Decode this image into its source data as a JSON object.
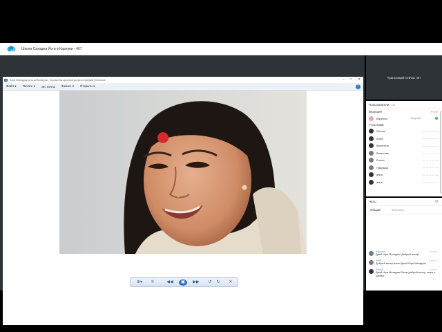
{
  "webinar": {
    "title": "Школа Сахаджа Йоги в Карелии - 407",
    "brand_color": "#2aa6e0"
  },
  "photo_viewer": {
    "window_title": "Шри Матаджи для вебинаров - Средство просмотра фотографий Windows",
    "menu": [
      "Файл ▾",
      "Печать ▾",
      "Эл. почта",
      "Запись ▾",
      "Открыть ▾"
    ],
    "help_label": "?",
    "window_buttons": [
      "–",
      "□",
      "✕"
    ],
    "toolbar_icons": [
      "zoom-icon",
      "fit-icon",
      "previous-icon",
      "slideshow-icon",
      "next-icon",
      "rotate-left-icon",
      "rotate-right-icon",
      "delete-icon"
    ],
    "toolbar_glyphs": [
      "⊕▾",
      "⁜",
      "◀◀",
      "▣",
      "▶▶",
      "↺",
      "↻",
      "✕"
    ]
  },
  "broadcast": {
    "status_text": "Трансляций сейчас нет"
  },
  "participants_panel": {
    "title": "Пользователи",
    "count": "16",
    "hosts_label": "Ведущие",
    "hosts_right": "Роли",
    "hosts": [
      {
        "name": "Карелия",
        "role": "ведущий"
      }
    ],
    "participants_label": "Участники",
    "participants": [
      {
        "name": "Илона"
      },
      {
        "name": "Анна"
      },
      {
        "name": "Валентин"
      },
      {
        "name": "Вячеслав"
      },
      {
        "name": "Елена"
      },
      {
        "name": "Надежда"
      },
      {
        "name": "анна"
      },
      {
        "name": "анна"
      }
    ]
  },
  "chat_panel": {
    "title": "Чаты",
    "tabs": [
      "Общий",
      "Фильтры"
    ],
    "messages": [
      {
        "author": "Карелия",
        "time": "7:16 PM",
        "text": "Джей Шри Матаджи! Добрый вечер!"
      },
      {
        "author": "Анна",
        "time": "7:18 PM",
        "text": "Добрый вечер всем! Джей Шри Матаджи!"
      },
      {
        "author": "Илона",
        "time": "7:19 PM",
        "text": "Джей Шри Матаджи! Всем добрый вечер, мира и любви!"
      }
    ]
  }
}
